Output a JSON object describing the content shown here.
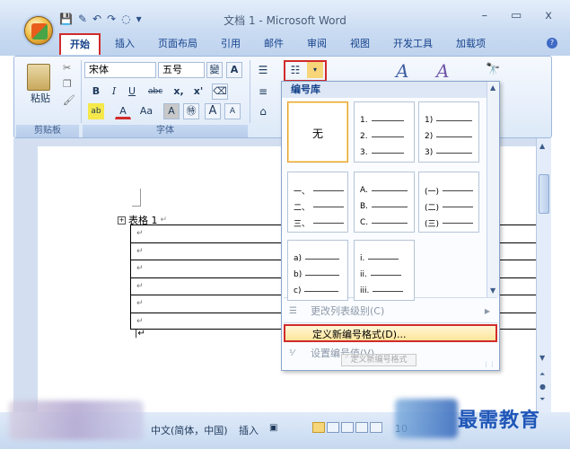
{
  "window": {
    "title": "文档 1 - Microsoft Word",
    "minimize": "–",
    "maximize": "▭",
    "close": "x"
  },
  "tabs": [
    {
      "label": "开始",
      "active": true
    },
    {
      "label": "插入"
    },
    {
      "label": "页面布局"
    },
    {
      "label": "引用"
    },
    {
      "label": "邮件"
    },
    {
      "label": "审阅"
    },
    {
      "label": "视图"
    },
    {
      "label": "开发工具"
    },
    {
      "label": "加载项"
    }
  ],
  "ribbon": {
    "paste_label": "粘贴",
    "clipboard_group": "剪贴板",
    "font_name": "宋体",
    "font_size": "五号",
    "font_group": "字体",
    "wen_btn": "變",
    "a_box_btn": "A",
    "bold": "B",
    "italic": "I",
    "underline": "U",
    "strike": "abc",
    "subscript": "x,",
    "superscript": "x'",
    "highlight": "ab",
    "font_color": "A",
    "case": "Aa",
    "char_shade": "A",
    "enclose": "㊕",
    "grow": "A",
    "shrink": "A"
  },
  "dropdown": {
    "header": "编号库",
    "none_label": "无",
    "tiles": [
      [
        "1.",
        "2.",
        "3."
      ],
      [
        "1)",
        "2)",
        "3)"
      ],
      [
        "一、",
        "二、",
        "三、"
      ],
      [
        "A.",
        "B.",
        "C."
      ],
      [
        "(一)",
        "(二)",
        "(三)"
      ],
      [
        "a)",
        "b)",
        "c)"
      ],
      [
        "i.",
        "ii.",
        "iii."
      ]
    ],
    "menu": {
      "change_level": "更改列表级别(C)",
      "define_new": "定义新编号格式(D)...",
      "set_value": "设置编号值(V)..."
    },
    "tooltip": "定义新编号格式"
  },
  "document": {
    "table_title": "表格 1",
    "paragraph_mark": "↵",
    "row_count": 6
  },
  "statusbar": {
    "language": "中文(简体，中国)",
    "mode": "插入",
    "zoom": "10"
  },
  "watermark": "最需教育"
}
